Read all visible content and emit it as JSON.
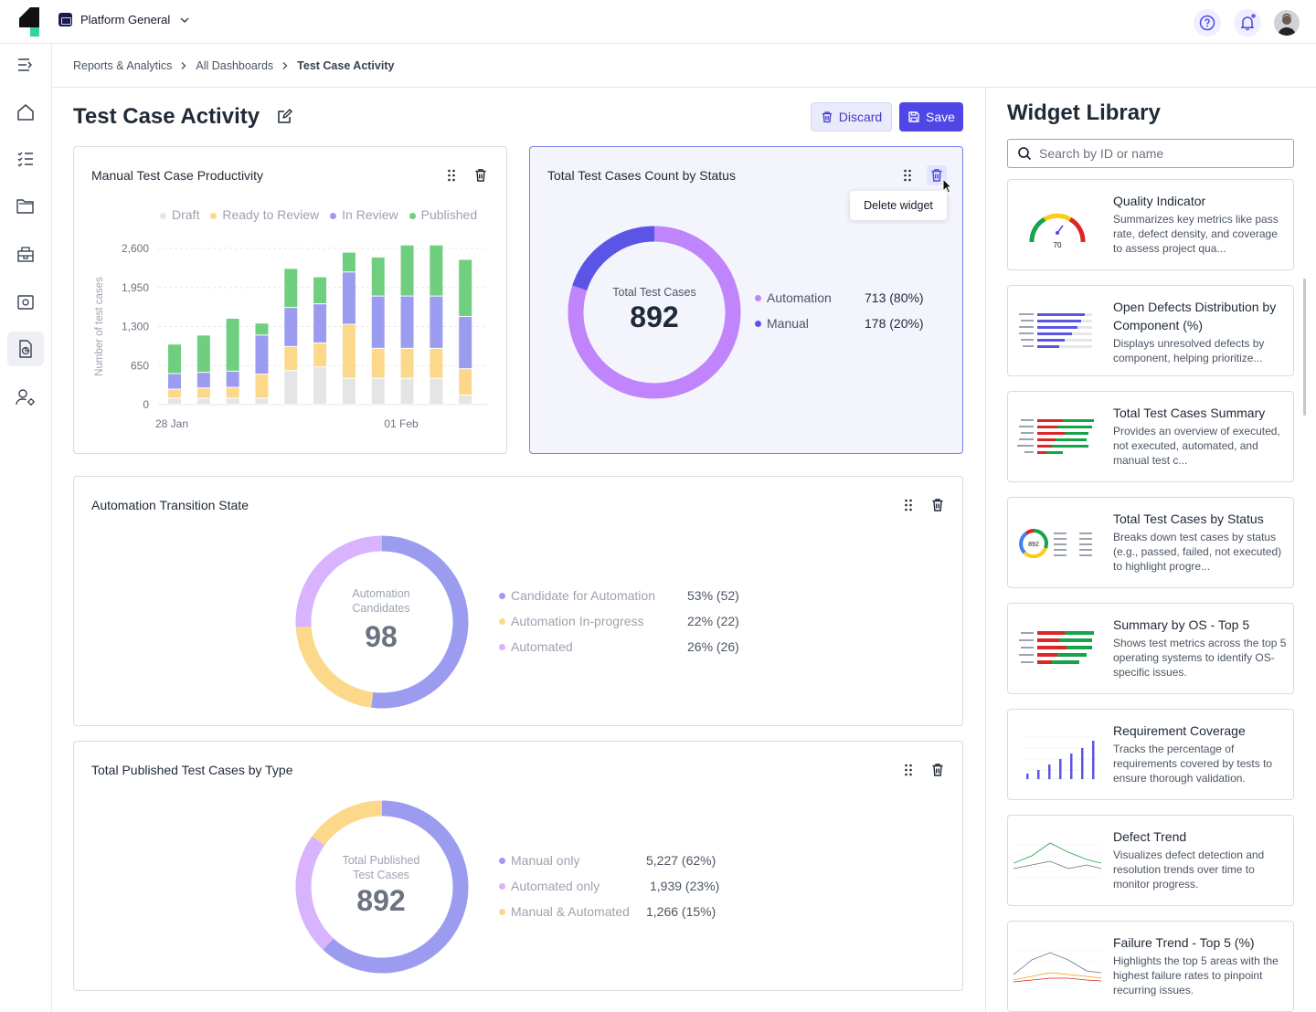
{
  "topbar": {
    "workspace": "Platform General"
  },
  "breadcrumb": [
    "Reports & Analytics",
    "All Dashboards",
    "Test Case Activity"
  ],
  "page": {
    "title": "Test Case Activity",
    "discard_label": "Discard",
    "save_label": "Save"
  },
  "widgets": {
    "productivity": {
      "title": "Manual Test Case Productivity",
      "legend": [
        "Draft",
        "Ready to Review",
        "In Review",
        "Published"
      ],
      "ylabel": "Number of test cases",
      "yticks": [
        "2,600",
        "1,950",
        "1,300",
        "650",
        "0"
      ],
      "xticks": [
        "28 Jan",
        "01 Feb"
      ]
    },
    "status": {
      "title": "Total Test Cases Count by Status",
      "tooltip": "Delete widget",
      "center_label": "Total Test Cases",
      "center_value": "892",
      "legend": [
        {
          "name": "Automation",
          "value": "713 (80%)"
        },
        {
          "name": "Manual",
          "value": "178 (20%)"
        }
      ]
    },
    "automation": {
      "title": "Automation Transition State",
      "center_label_1": "Automation",
      "center_label_2": "Candidates",
      "center_value": "98",
      "legend": [
        {
          "name": "Candidate for Automation",
          "value": "53% (52)"
        },
        {
          "name": "Automation In-progress",
          "value": "22% (22)"
        },
        {
          "name": "Automated",
          "value": "26% (26)"
        }
      ]
    },
    "published": {
      "title": "Total Published Test Cases by Type",
      "center_label_1": "Total Published",
      "center_label_2": "Test Cases",
      "center_value": "892",
      "legend": [
        {
          "name": "Manual only",
          "value": "5,227 (62%)"
        },
        {
          "name": "Automated only",
          "value": "1,939 (23%)"
        },
        {
          "name": "Manual & Automated",
          "value": "1,266 (15%)"
        }
      ]
    }
  },
  "library": {
    "title": "Widget Library",
    "search_placeholder": "Search by ID or name",
    "gauge_value": "70",
    "donut_value": "892",
    "items": [
      {
        "title": "Quality Indicator",
        "desc": "Summarizes key metrics like pass rate, defect density, and coverage to assess project qua..."
      },
      {
        "title": "Open Defects Distribution by Component (%)",
        "desc": "Displays unresolved defects by component, helping prioritize..."
      },
      {
        "title": "Total Test Cases Summary",
        "desc": "Provides an overview of executed, not executed, automated, and manual test c..."
      },
      {
        "title": "Total Test Cases by Status",
        "desc": "Breaks down test cases by status (e.g., passed, failed, not executed) to highlight progre..."
      },
      {
        "title": "Summary by OS - Top 5",
        "desc": "Shows test metrics across the top 5 operating systems to identify OS-specific issues."
      },
      {
        "title": "Requirement Coverage",
        "desc": "Tracks the percentage of requirements covered by tests to ensure thorough validation."
      },
      {
        "title": "Defect Trend",
        "desc": "Visualizes defect detection and resolution trends over time to monitor progress."
      },
      {
        "title": "Failure Trend - Top 5 (%)",
        "desc": "Highlights the top 5 areas with the highest failure rates to pinpoint recurring issues."
      }
    ]
  },
  "colors": {
    "accent": "#4f46e5",
    "draft": "#e5e5e5",
    "ready": "#fcd98a",
    "in_review": "#9b9cf0",
    "published": "#6fcf7f",
    "automation": "#c084fc",
    "manual": "#5b55e6",
    "candidate": "#9b9cf0",
    "inprogress": "#fcd98a",
    "automated": "#d8b4fe"
  },
  "chart_data": [
    {
      "type": "bar",
      "title": "Manual Test Case Productivity",
      "ylabel": "Number of test cases",
      "ylim": [
        0,
        2600
      ],
      "x_tick_labels": [
        "28 Jan",
        "01 Feb"
      ],
      "series": [
        {
          "name": "Draft",
          "values": [
            100,
            100,
            100,
            100,
            560,
            620,
            430,
            430,
            430,
            430,
            150
          ]
        },
        {
          "name": "Ready to Review",
          "values": [
            150,
            170,
            180,
            400,
            400,
            400,
            900,
            500,
            500,
            500,
            440
          ]
        },
        {
          "name": "In Review",
          "values": [
            260,
            260,
            270,
            650,
            650,
            650,
            870,
            870,
            870,
            870,
            870
          ]
        },
        {
          "name": "Published",
          "values": [
            490,
            620,
            880,
            200,
            650,
            450,
            330,
            650,
            850,
            850,
            950
          ]
        }
      ]
    },
    {
      "type": "pie",
      "title": "Total Test Cases Count by Status",
      "categories": [
        "Automation",
        "Manual"
      ],
      "values": [
        713,
        178
      ]
    },
    {
      "type": "pie",
      "title": "Automation Transition State",
      "categories": [
        "Candidate for Automation",
        "Automation In-progress",
        "Automated"
      ],
      "values": [
        52,
        22,
        26
      ]
    },
    {
      "type": "pie",
      "title": "Total Published Test Cases by Type",
      "categories": [
        "Manual only",
        "Automated only",
        "Manual & Automated"
      ],
      "values": [
        5227,
        1939,
        1266
      ]
    }
  ]
}
